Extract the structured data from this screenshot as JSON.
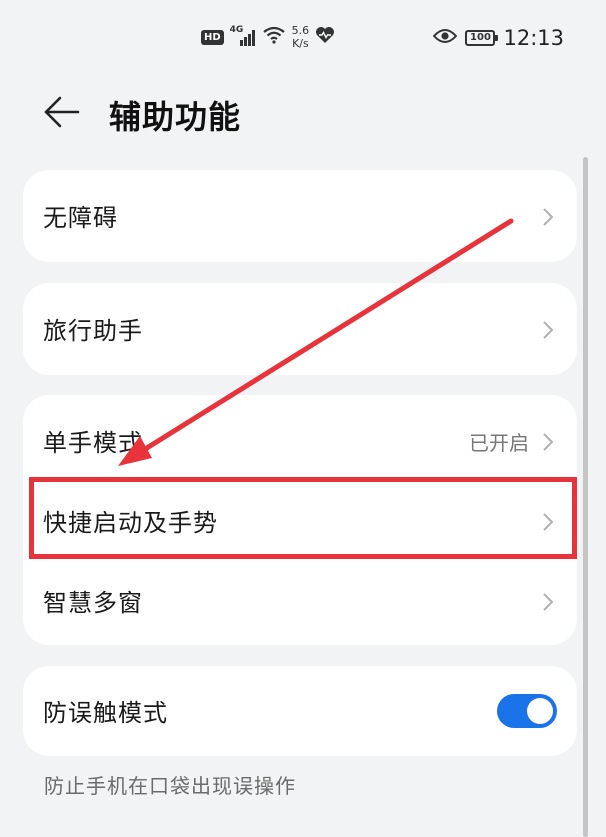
{
  "status_bar": {
    "hd": "HD",
    "network": "4G",
    "speed_value": "5.6",
    "speed_unit": "K/s",
    "battery": "100",
    "time": "12:13"
  },
  "header": {
    "title": "辅助功能"
  },
  "groups": {
    "accessibility": {
      "label": "无障碍"
    },
    "travel": {
      "label": "旅行助手"
    },
    "one_hand": {
      "label": "单手模式",
      "value": "已开启"
    },
    "shortcuts": {
      "label": "快捷启动及手势"
    },
    "multi_window": {
      "label": "智慧多窗"
    },
    "pocket_mode": {
      "label": "防误触模式",
      "enabled": true,
      "description": "防止手机在口袋出现误操作"
    }
  },
  "colors": {
    "accent": "#1a73e8",
    "annotation": "#e8333a",
    "background": "#f1f3f5"
  }
}
